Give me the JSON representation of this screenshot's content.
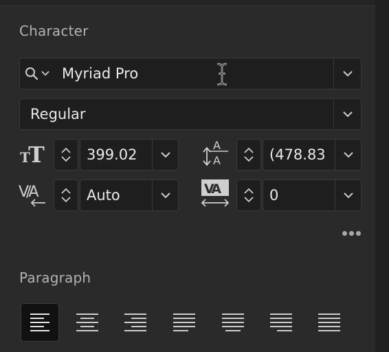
{
  "character": {
    "title": "Character",
    "font_family": {
      "value": "Myriad Pro",
      "search_icon": "search-icon",
      "chevron": "chevron-down-icon"
    },
    "font_style": {
      "value": "Regular"
    },
    "font_size": {
      "value": "399.02",
      "icon": "font-size-icon"
    },
    "leading": {
      "value": "(478.83",
      "icon": "leading-icon"
    },
    "kerning": {
      "value": "Auto",
      "icon": "kerning-icon"
    },
    "tracking": {
      "value": "0",
      "icon": "tracking-icon"
    },
    "more_icon": "more-options-icon"
  },
  "paragraph": {
    "title": "Paragraph",
    "alignments": [
      {
        "name": "align-left",
        "selected": true
      },
      {
        "name": "align-center",
        "selected": false
      },
      {
        "name": "align-right",
        "selected": false
      },
      {
        "name": "justify-last-left",
        "selected": false
      },
      {
        "name": "justify-last-center",
        "selected": false
      },
      {
        "name": "justify-last-right",
        "selected": false
      },
      {
        "name": "justify-all",
        "selected": false
      }
    ]
  },
  "colors": {
    "panel": "#2a2a2a",
    "field": "#1e1e1e",
    "border": "#3a3a3a",
    "text": "#eaeaea",
    "label": "#b3b3b3"
  }
}
